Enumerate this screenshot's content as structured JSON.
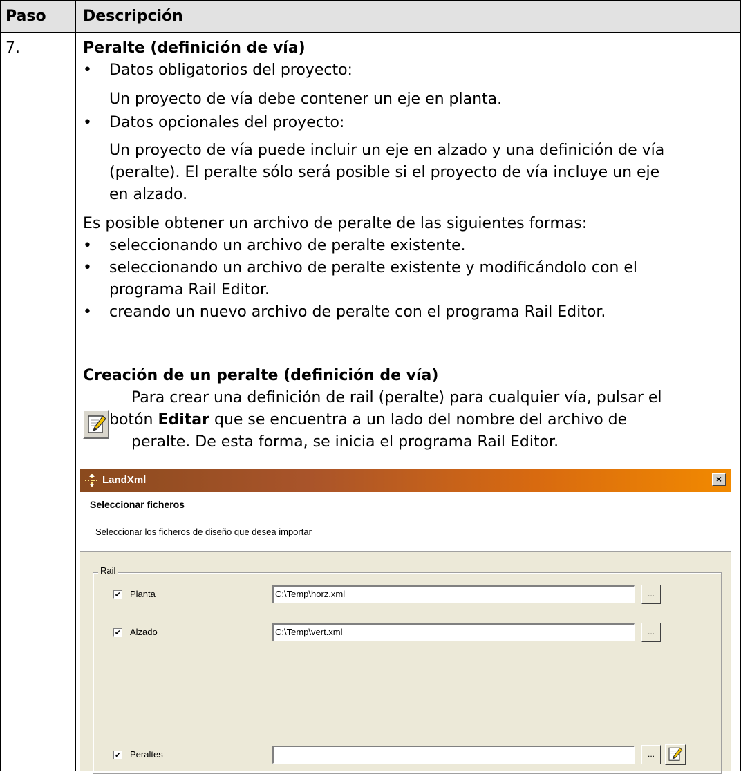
{
  "table": {
    "header": {
      "col1": "Paso",
      "col2": "Descripción"
    },
    "step_number": "7.",
    "section_title": "Peralte (definición de vía)",
    "bullets_1": [
      {
        "title": "Datos obligatorios del proyecto:",
        "detail": [
          "Un proyecto de vía debe contener un eje en planta."
        ]
      },
      {
        "title": "Datos opcionales del proyecto:",
        "detail": [
          "Un proyecto de vía puede incluir un eje en alzado y una definición de vía",
          "(peralte). El peralte sólo será posible si el proyecto de vía incluye un eje",
          "en alzado."
        ]
      }
    ],
    "intro": "Es posible obtener un archivo de peralte de las siguientes formas:",
    "bullets_2": [
      [
        "seleccionando un archivo de peralte existente."
      ],
      [
        "seleccionando un archivo de peralte existente y modificándolo con el",
        "programa Rail Editor."
      ],
      [
        "creando un nuevo archivo de peralte con el programa Rail Editor."
      ]
    ],
    "subsection_title": "Creación de un peralte (definición de vía)",
    "edit_note": {
      "line1": "Para crear una definición de rail (peralte) para cualquier vía, pulsar el",
      "line2_pre": "botón ",
      "line2_bold": "Editar",
      "line2_post": " que se encuentra a un lado del nombre del archivo de",
      "line3": "peralte. De esta forma, se inicia el programa Rail Editor.",
      "icon": "edit-pencil-icon"
    }
  },
  "dialog": {
    "title": "LandXml",
    "close_label": "×",
    "heading": "Seleccionar ficheros",
    "subheading": "Seleccionar los ficheros de diseño que desea importar",
    "group_label": "Rail",
    "browse_label": "...",
    "rows": [
      {
        "label": "Planta",
        "checked": true,
        "value": "C:\\Temp\\horz.xml"
      },
      {
        "label": "Alzado",
        "checked": true,
        "value": "C:\\Temp\\vert.xml"
      },
      {
        "label": "Peraltes",
        "checked": true,
        "value": ""
      }
    ]
  },
  "colors": {
    "header_bg": "#e2e2e2",
    "dialog_bg": "#ece9d8",
    "title_gradient_start": "#8a4a1e",
    "title_gradient_end": "#f28a00"
  }
}
